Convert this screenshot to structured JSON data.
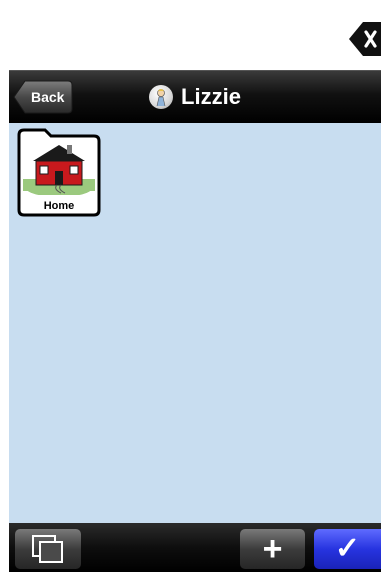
{
  "nav": {
    "back_label": "Back",
    "title": "Lizzie",
    "avatar_icon": "user-avatar-icon"
  },
  "board": {
    "background_color": "#c8ddf0",
    "items": [
      {
        "label": "Home",
        "icon": "house-icon"
      }
    ]
  },
  "toolbar": {
    "windows_icon": "windows-icon",
    "add_label": "+",
    "done_label": "✓",
    "done_color": "#2734e0"
  },
  "clear_icon": "backspace-clear-icon"
}
